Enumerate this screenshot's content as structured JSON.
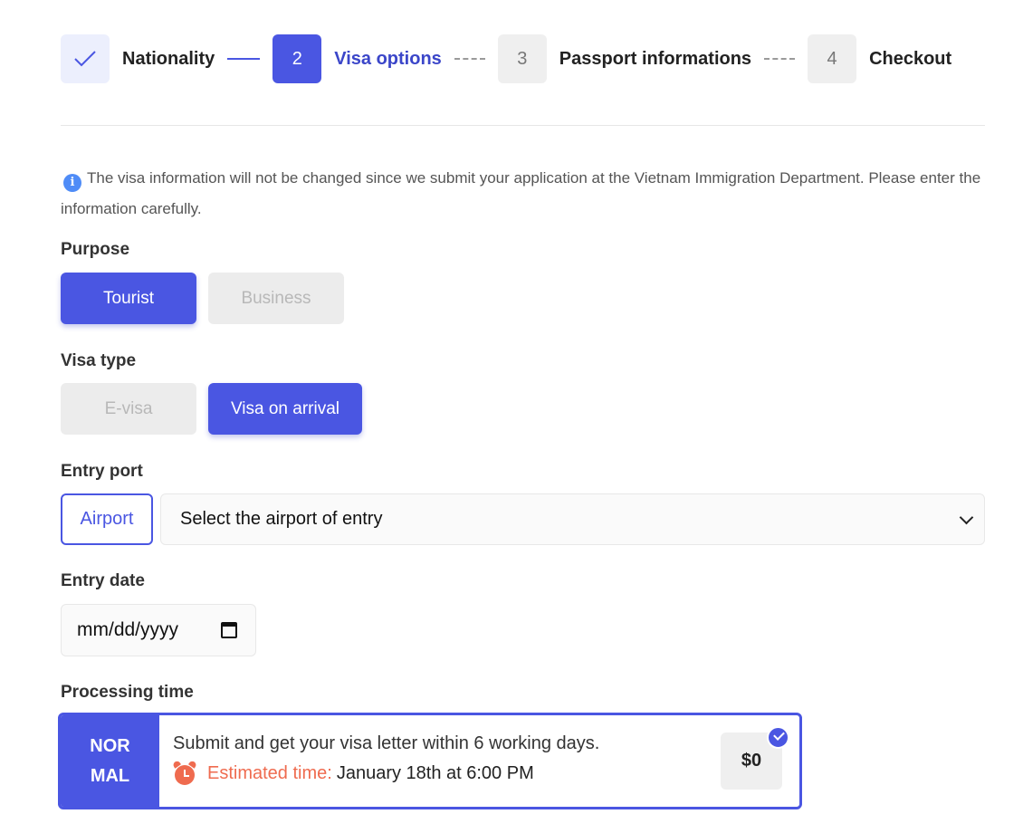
{
  "stepper": {
    "steps": [
      {
        "number": "",
        "label": "Nationality",
        "state": "done",
        "icon": "check-icon"
      },
      {
        "number": "2",
        "label": "Visa options",
        "state": "active"
      },
      {
        "number": "3",
        "label": "Passport informations",
        "state": "pending"
      },
      {
        "number": "4",
        "label": "Checkout",
        "state": "pending"
      }
    ]
  },
  "notice": {
    "icon": "info-icon",
    "text": "The visa information will not be changed since we submit your application at the Vietnam Immigration Department. Please enter the information carefully."
  },
  "purpose": {
    "label": "Purpose",
    "options": [
      {
        "label": "Tourist",
        "selected": true
      },
      {
        "label": "Business",
        "selected": false
      }
    ]
  },
  "visa_type": {
    "label": "Visa type",
    "options": [
      {
        "label": "E-visa",
        "selected": false
      },
      {
        "label": "Visa on arrival",
        "selected": true
      }
    ]
  },
  "entry_port": {
    "label": "Entry port",
    "badge": "Airport",
    "select_value": "Select the airport of entry"
  },
  "entry_date": {
    "label": "Entry date",
    "value": "mm/dd/yyyy"
  },
  "processing_time": {
    "label": "Processing time",
    "option": {
      "tag": "NORMAL",
      "description": "Submit and get your visa letter within 6 working days.",
      "estimated_label": "Estimated time:",
      "estimated_value": "January 18th at 6:00 PM",
      "price": "$0",
      "selected": true
    }
  },
  "colors": {
    "accent": "#4a56e2",
    "warning": "#ef6b4f",
    "info": "#4f8cf7"
  }
}
